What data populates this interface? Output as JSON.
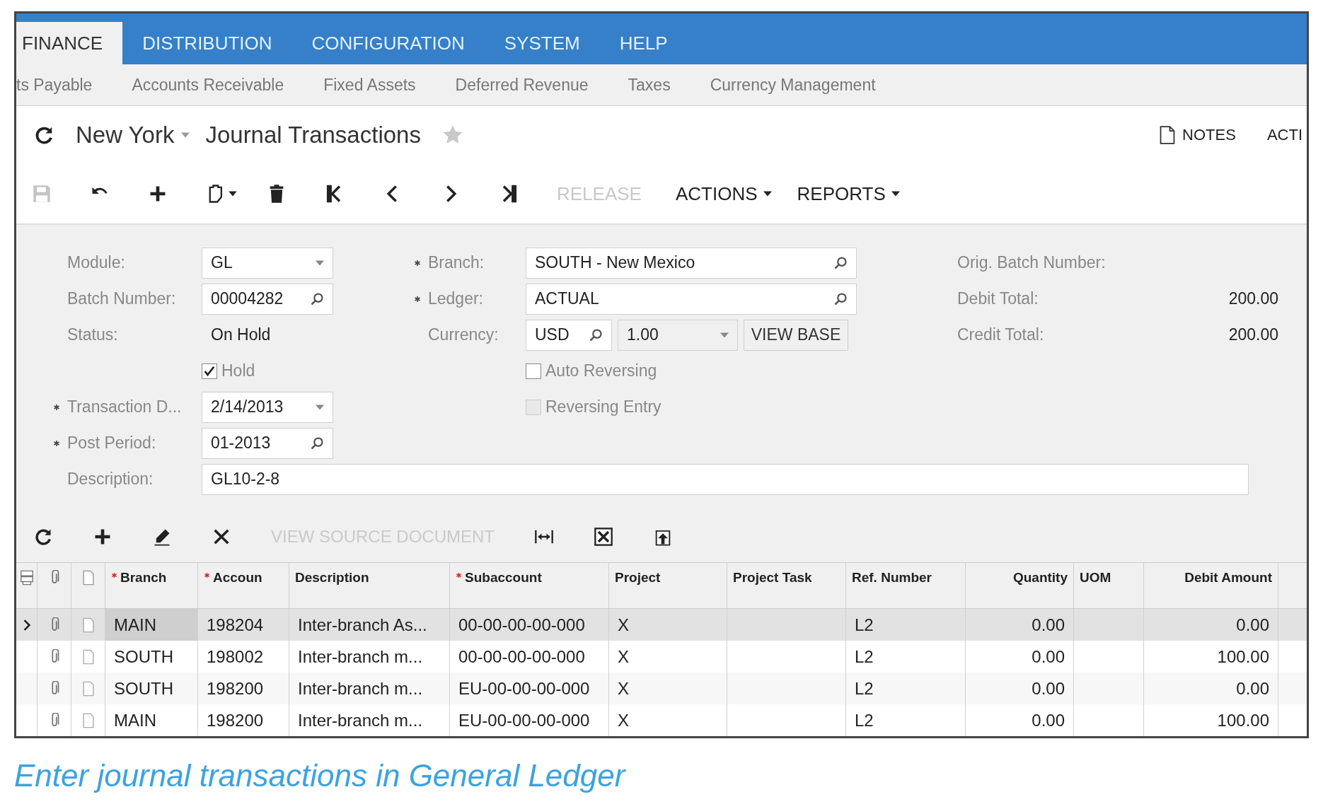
{
  "top_nav": [
    {
      "label": "FINANCE",
      "selected": true
    },
    {
      "label": "DISTRIBUTION",
      "selected": false
    },
    {
      "label": "CONFIGURATION",
      "selected": false
    },
    {
      "label": "SYSTEM",
      "selected": false
    },
    {
      "label": "HELP",
      "selected": false
    }
  ],
  "sub_nav": [
    "ts Payable",
    "Accounts Receivable",
    "Fixed Assets",
    "Deferred Revenue",
    "Taxes",
    "Currency Management"
  ],
  "title": {
    "location": "New York",
    "screen": "Journal Transactions",
    "favorite": false
  },
  "header_links": [
    "NOTES",
    "ACTI"
  ],
  "toolbar": {
    "save_enabled": false,
    "buttons": [
      {
        "label": "RELEASE",
        "disabled": true,
        "dropdown": false
      },
      {
        "label": "ACTIONS",
        "disabled": false,
        "dropdown": true
      },
      {
        "label": "REPORTS",
        "disabled": false,
        "dropdown": true
      }
    ]
  },
  "form": {
    "left": [
      {
        "label": "Module:",
        "required": false,
        "kind": "select",
        "value": "GL"
      },
      {
        "label": "Batch Number:",
        "required": false,
        "kind": "lookup",
        "value": "00004282"
      },
      {
        "label": "Status:",
        "required": false,
        "kind": "text",
        "value": "On Hold"
      },
      {
        "label": "Hold",
        "kind": "checkbox",
        "checked": true,
        "disabled": false
      },
      {
        "label": "Transaction D...",
        "required": true,
        "kind": "select",
        "value": "2/14/2013"
      },
      {
        "label": "Post Period:",
        "required": true,
        "kind": "lookup",
        "value": "01-2013"
      }
    ],
    "middle": [
      {
        "label": "Branch:",
        "required": true,
        "kind": "lookup",
        "value": "SOUTH - New Mexico"
      },
      {
        "label": "Ledger:",
        "required": true,
        "kind": "lookup",
        "value": "ACTUAL"
      },
      {
        "label": "Currency:",
        "required": false,
        "kind": "currency",
        "value": "USD",
        "rate": "1.00",
        "button": "VIEW BASE"
      },
      {
        "label": "Auto Reversing",
        "kind": "checkbox",
        "checked": false,
        "disabled": false
      },
      {
        "label": "Reversing Entry",
        "kind": "checkbox",
        "checked": false,
        "disabled": true
      }
    ],
    "right": [
      {
        "label": "Orig. Batch Number:"
      },
      {
        "label": "Debit Total:",
        "value": "200.00"
      },
      {
        "label": "Credit Total:",
        "value": "200.00"
      }
    ],
    "description": {
      "label": "Description:",
      "value": "GL10-2-8"
    }
  },
  "grid_toolbar": {
    "buttons": [
      {
        "label": "VIEW SOURCE DOCUMENT",
        "disabled": true
      }
    ]
  },
  "table": {
    "columns": [
      {
        "label": "Branch",
        "required": true,
        "kind": "text"
      },
      {
        "label": "Accoun",
        "required": true,
        "kind": "text"
      },
      {
        "label": "Description",
        "required": false,
        "kind": "text"
      },
      {
        "label": "Subaccount",
        "required": true,
        "kind": "text"
      },
      {
        "label": "Project",
        "required": false,
        "kind": "text"
      },
      {
        "label": "Project Task",
        "required": false,
        "kind": "text"
      },
      {
        "label": "Ref. Number",
        "required": false,
        "kind": "text"
      },
      {
        "label": "Quantity",
        "required": false,
        "kind": "number"
      },
      {
        "label": "UOM",
        "required": false,
        "kind": "text"
      },
      {
        "label": "Debit Amount",
        "required": false,
        "kind": "number"
      }
    ],
    "rows": [
      {
        "selected": true,
        "cells": [
          "MAIN",
          "198204",
          "Inter-branch As...",
          "00-00-00-00-000",
          "X",
          null,
          "L2",
          "0.00",
          null,
          "0.00"
        ]
      },
      {
        "selected": false,
        "cells": [
          "SOUTH",
          "198002",
          "Inter-branch m...",
          "00-00-00-00-000",
          "X",
          null,
          "L2",
          "0.00",
          null,
          "100.00"
        ]
      },
      {
        "selected": false,
        "cells": [
          "SOUTH",
          "198200",
          "Inter-branch m...",
          "EU-00-00-00-000",
          "X",
          null,
          "L2",
          "0.00",
          null,
          "0.00"
        ]
      },
      {
        "selected": false,
        "cells": [
          "MAIN",
          "198200",
          "Inter-branch m...",
          "EU-00-00-00-000",
          "X",
          null,
          "L2",
          "0.00",
          null,
          "100.00"
        ]
      }
    ]
  },
  "caption": "Enter journal transactions in General Ledger"
}
